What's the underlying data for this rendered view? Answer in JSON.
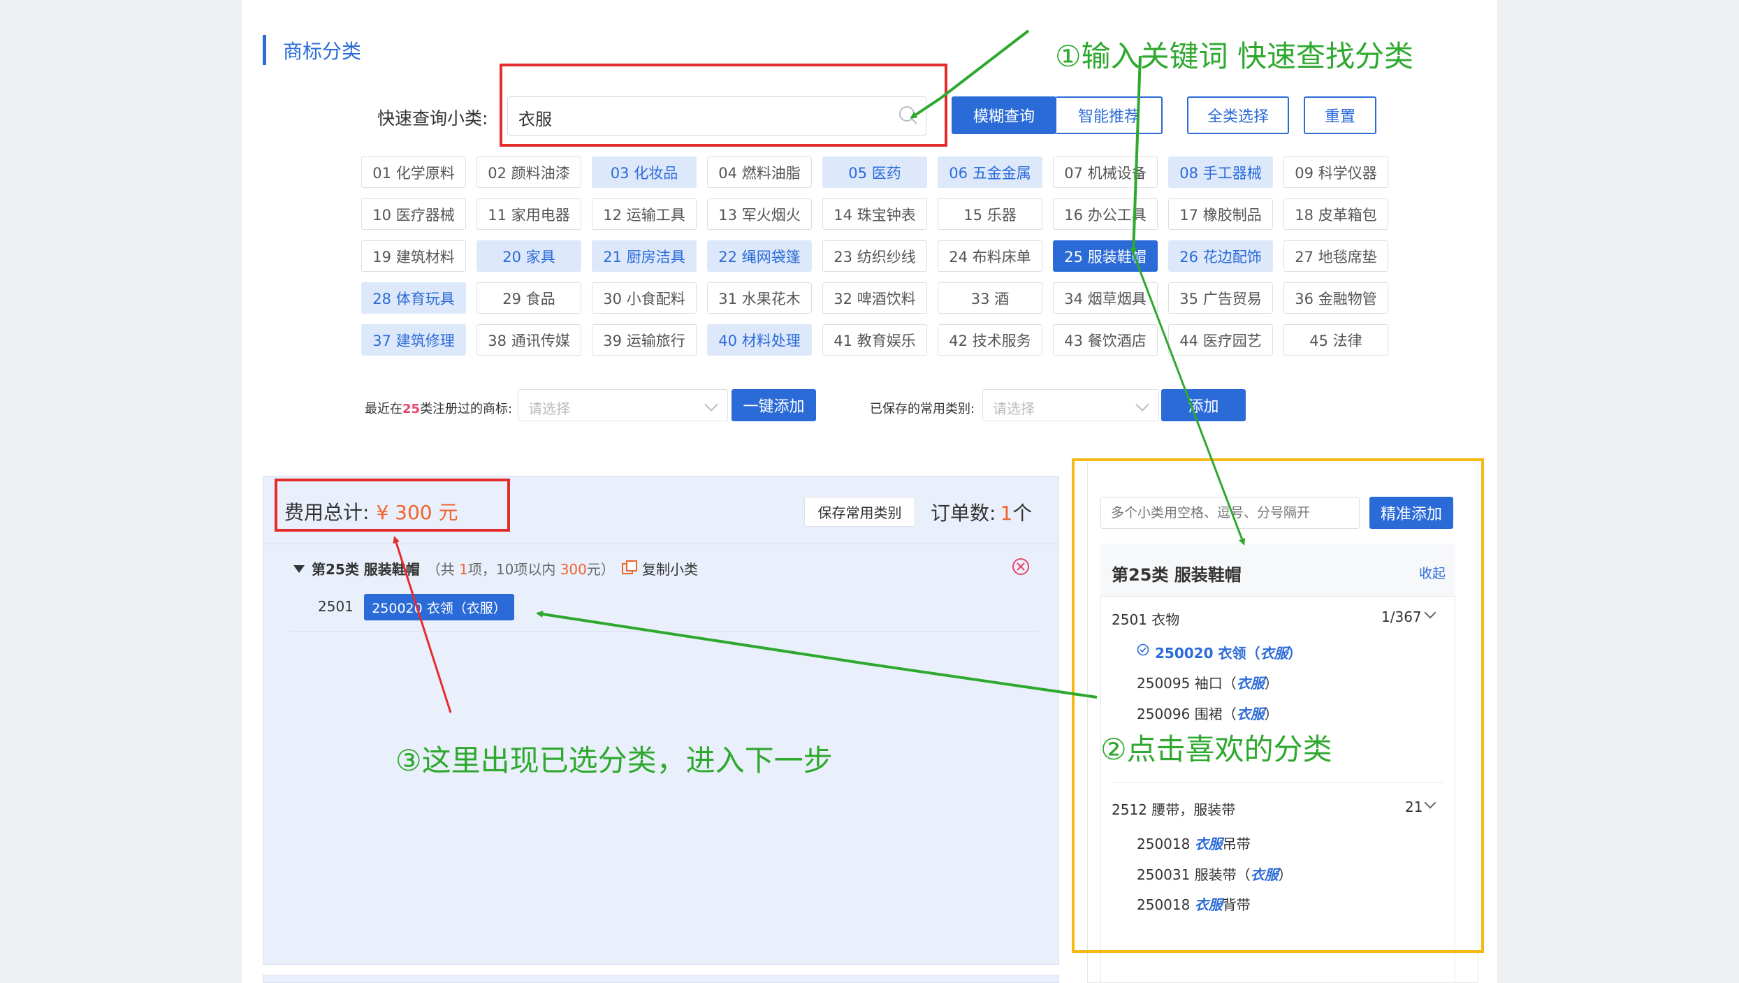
{
  "section": {
    "title": "商标分类"
  },
  "search": {
    "label": "快速查询小类:",
    "value": "衣服",
    "fuzzy_btn": "模糊查询",
    "smart_btn": "智能推荐",
    "select_all_btn": "全类选择",
    "reset_btn": "重置"
  },
  "classes": [
    {
      "label": "01 化学原料",
      "state": "normal"
    },
    {
      "label": "02 颜料油漆",
      "state": "normal"
    },
    {
      "label": "03 化妆品",
      "state": "highlight"
    },
    {
      "label": "04 燃料油脂",
      "state": "normal"
    },
    {
      "label": "05 医药",
      "state": "highlight"
    },
    {
      "label": "06 五金金属",
      "state": "highlight"
    },
    {
      "label": "07 机械设备",
      "state": "normal"
    },
    {
      "label": "08 手工器械",
      "state": "highlight"
    },
    {
      "label": "09 科学仪器",
      "state": "normal"
    },
    {
      "label": "10 医疗器械",
      "state": "normal"
    },
    {
      "label": "11 家用电器",
      "state": "normal"
    },
    {
      "label": "12 运输工具",
      "state": "normal"
    },
    {
      "label": "13 军火烟火",
      "state": "normal"
    },
    {
      "label": "14 珠宝钟表",
      "state": "normal"
    },
    {
      "label": "15 乐器",
      "state": "normal"
    },
    {
      "label": "16 办公工具",
      "state": "normal"
    },
    {
      "label": "17 橡胶制品",
      "state": "normal"
    },
    {
      "label": "18 皮革箱包",
      "state": "normal"
    },
    {
      "label": "19 建筑材料",
      "state": "normal"
    },
    {
      "label": "20 家具",
      "state": "highlight"
    },
    {
      "label": "21 厨房洁具",
      "state": "highlight"
    },
    {
      "label": "22 绳网袋篷",
      "state": "highlight"
    },
    {
      "label": "23 纺织纱线",
      "state": "normal"
    },
    {
      "label": "24 布料床单",
      "state": "normal"
    },
    {
      "label": "25 服装鞋帽",
      "state": "active"
    },
    {
      "label": "26 花边配饰",
      "state": "highlight"
    },
    {
      "label": "27 地毯席垫",
      "state": "normal"
    },
    {
      "label": "28 体育玩具",
      "state": "highlight"
    },
    {
      "label": "29 食品",
      "state": "normal"
    },
    {
      "label": "30 小食配料",
      "state": "normal"
    },
    {
      "label": "31 水果花木",
      "state": "normal"
    },
    {
      "label": "32 啤酒饮料",
      "state": "normal"
    },
    {
      "label": "33 酒",
      "state": "normal"
    },
    {
      "label": "34 烟草烟具",
      "state": "normal"
    },
    {
      "label": "35 广告贸易",
      "state": "normal"
    },
    {
      "label": "36 金融物管",
      "state": "normal"
    },
    {
      "label": "37 建筑修理",
      "state": "highlight"
    },
    {
      "label": "38 通讯传媒",
      "state": "normal"
    },
    {
      "label": "39 运输旅行",
      "state": "normal"
    },
    {
      "label": "40 材料处理",
      "state": "highlight"
    },
    {
      "label": "41 教育娱乐",
      "state": "normal"
    },
    {
      "label": "42 技术服务",
      "state": "normal"
    },
    {
      "label": "43 餐饮酒店",
      "state": "normal"
    },
    {
      "label": "44 医疗园艺",
      "state": "normal"
    },
    {
      "label": "45 法律",
      "state": "normal"
    }
  ],
  "recent": {
    "label_prefix": "最近在",
    "label_num": "25",
    "label_suffix": "类注册过的商标:",
    "placeholder": "请选择",
    "add_btn": "一键添加"
  },
  "saved": {
    "label": "已保存的常用类别:",
    "placeholder": "请选择",
    "add_btn": "添加"
  },
  "summary": {
    "total_label": "费用总计:",
    "total_value": "¥ 300 元",
    "save_btn": "保存常用类别",
    "order_label": "订单数:",
    "order_count": "1",
    "order_unit": "个"
  },
  "selected_group": {
    "title": "第25类 服装鞋帽",
    "detail_prefix": "（共 ",
    "detail_count": "1",
    "detail_mid": "项，10项以内 ",
    "detail_price": "300",
    "detail_suffix": "元）",
    "copy_link": "复制小类",
    "sub_code": "2501",
    "item_tag": "250020 衣领（衣服）"
  },
  "right": {
    "input_placeholder": "多个小类用空格、逗号、分号隔开",
    "precise_btn": "精准添加",
    "tree_title": "第25类 服装鞋帽",
    "collapse_link": "收起",
    "group1": {
      "title": "2501 衣物",
      "count": "1/367",
      "items": [
        {
          "code": "250020 衣领（",
          "kw": "衣服",
          "tail": "）",
          "selected": true
        },
        {
          "code": "250095 袖口（",
          "kw": "衣服",
          "tail": "）",
          "selected": false
        },
        {
          "code": "250096 围裙（",
          "kw": "衣服",
          "tail": "）",
          "selected": false
        }
      ]
    },
    "group2": {
      "title": "2512 腰带，服装带",
      "count": "21",
      "items": [
        {
          "code": "250018 ",
          "kw": "衣服",
          "tail": "吊带"
        },
        {
          "code": "250031 服装带（",
          "kw": "衣服",
          "tail": "）"
        },
        {
          "code": "250018 ",
          "kw": "衣服",
          "tail": "背带"
        }
      ]
    }
  },
  "annotations": {
    "step1": "①输入关键词 快速查找分类",
    "step2": "②点击喜欢的分类",
    "step3": "③这里出现已选分类，进入下一步"
  },
  "colors": {
    "primary": "#2b6bd8",
    "highlight_bg": "#dde8fb",
    "annotation_green": "#2ea82e",
    "annotation_red": "#e42c2c",
    "annotation_yellow": "#f4b915",
    "price_orange": "#f0642d"
  }
}
